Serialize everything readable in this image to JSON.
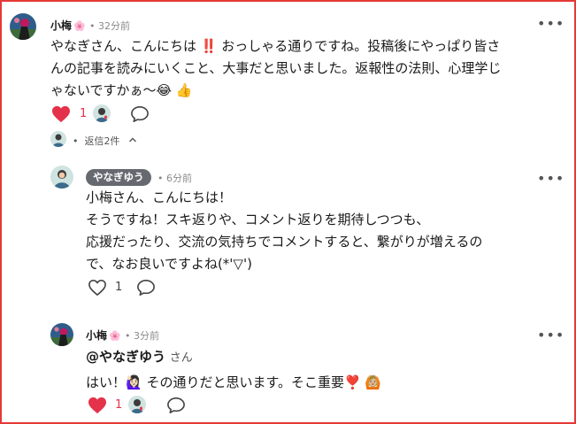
{
  "comments": [
    {
      "author": "小梅",
      "flower": "🌸",
      "time": "32分前",
      "lines": [
        "やなぎさん、こんにちは ‼️ おっしゃる通りですね。投稿後にやっぱり皆さ",
        "んの記事を読みにいくこと、大事だと思いました。返報性の法則、心理学じ",
        "ゃないですかぁ～😂 👍"
      ],
      "like_count": "1",
      "replies_label": "返信2件",
      "replies_toggle": "^"
    },
    {
      "author": "やなぎゆう",
      "time": "6分前",
      "lines": [
        "小梅さん、こんにちは！",
        "そうですね！スキ返りや、コメント返りを期待しつつも、",
        "応援だったり、交流の気持ちでコメントすると、繋がりが増えるの",
        "で、なお良いですよね(*'▽')"
      ],
      "like_count": "1"
    },
    {
      "author": "小梅",
      "flower": "🌸",
      "time": "3分前",
      "mention": "@やなぎゆう",
      "mention_suffix": "さん",
      "reply_text": "はい！🙋🏻‍♀️ その通りだと思います。そこ重要❣️ 🙆🏼",
      "like_count": "1"
    }
  ],
  "separator": "•",
  "more_symbol": "•••",
  "colors": {
    "frame": "#e53935",
    "like_red": "#e5324b",
    "pill_bg": "#666a70"
  },
  "icons": [
    "heart-filled-icon",
    "heart-outline-icon",
    "comment-icon",
    "more-icon",
    "chevron-up-icon",
    "liker-avatar-icon"
  ]
}
